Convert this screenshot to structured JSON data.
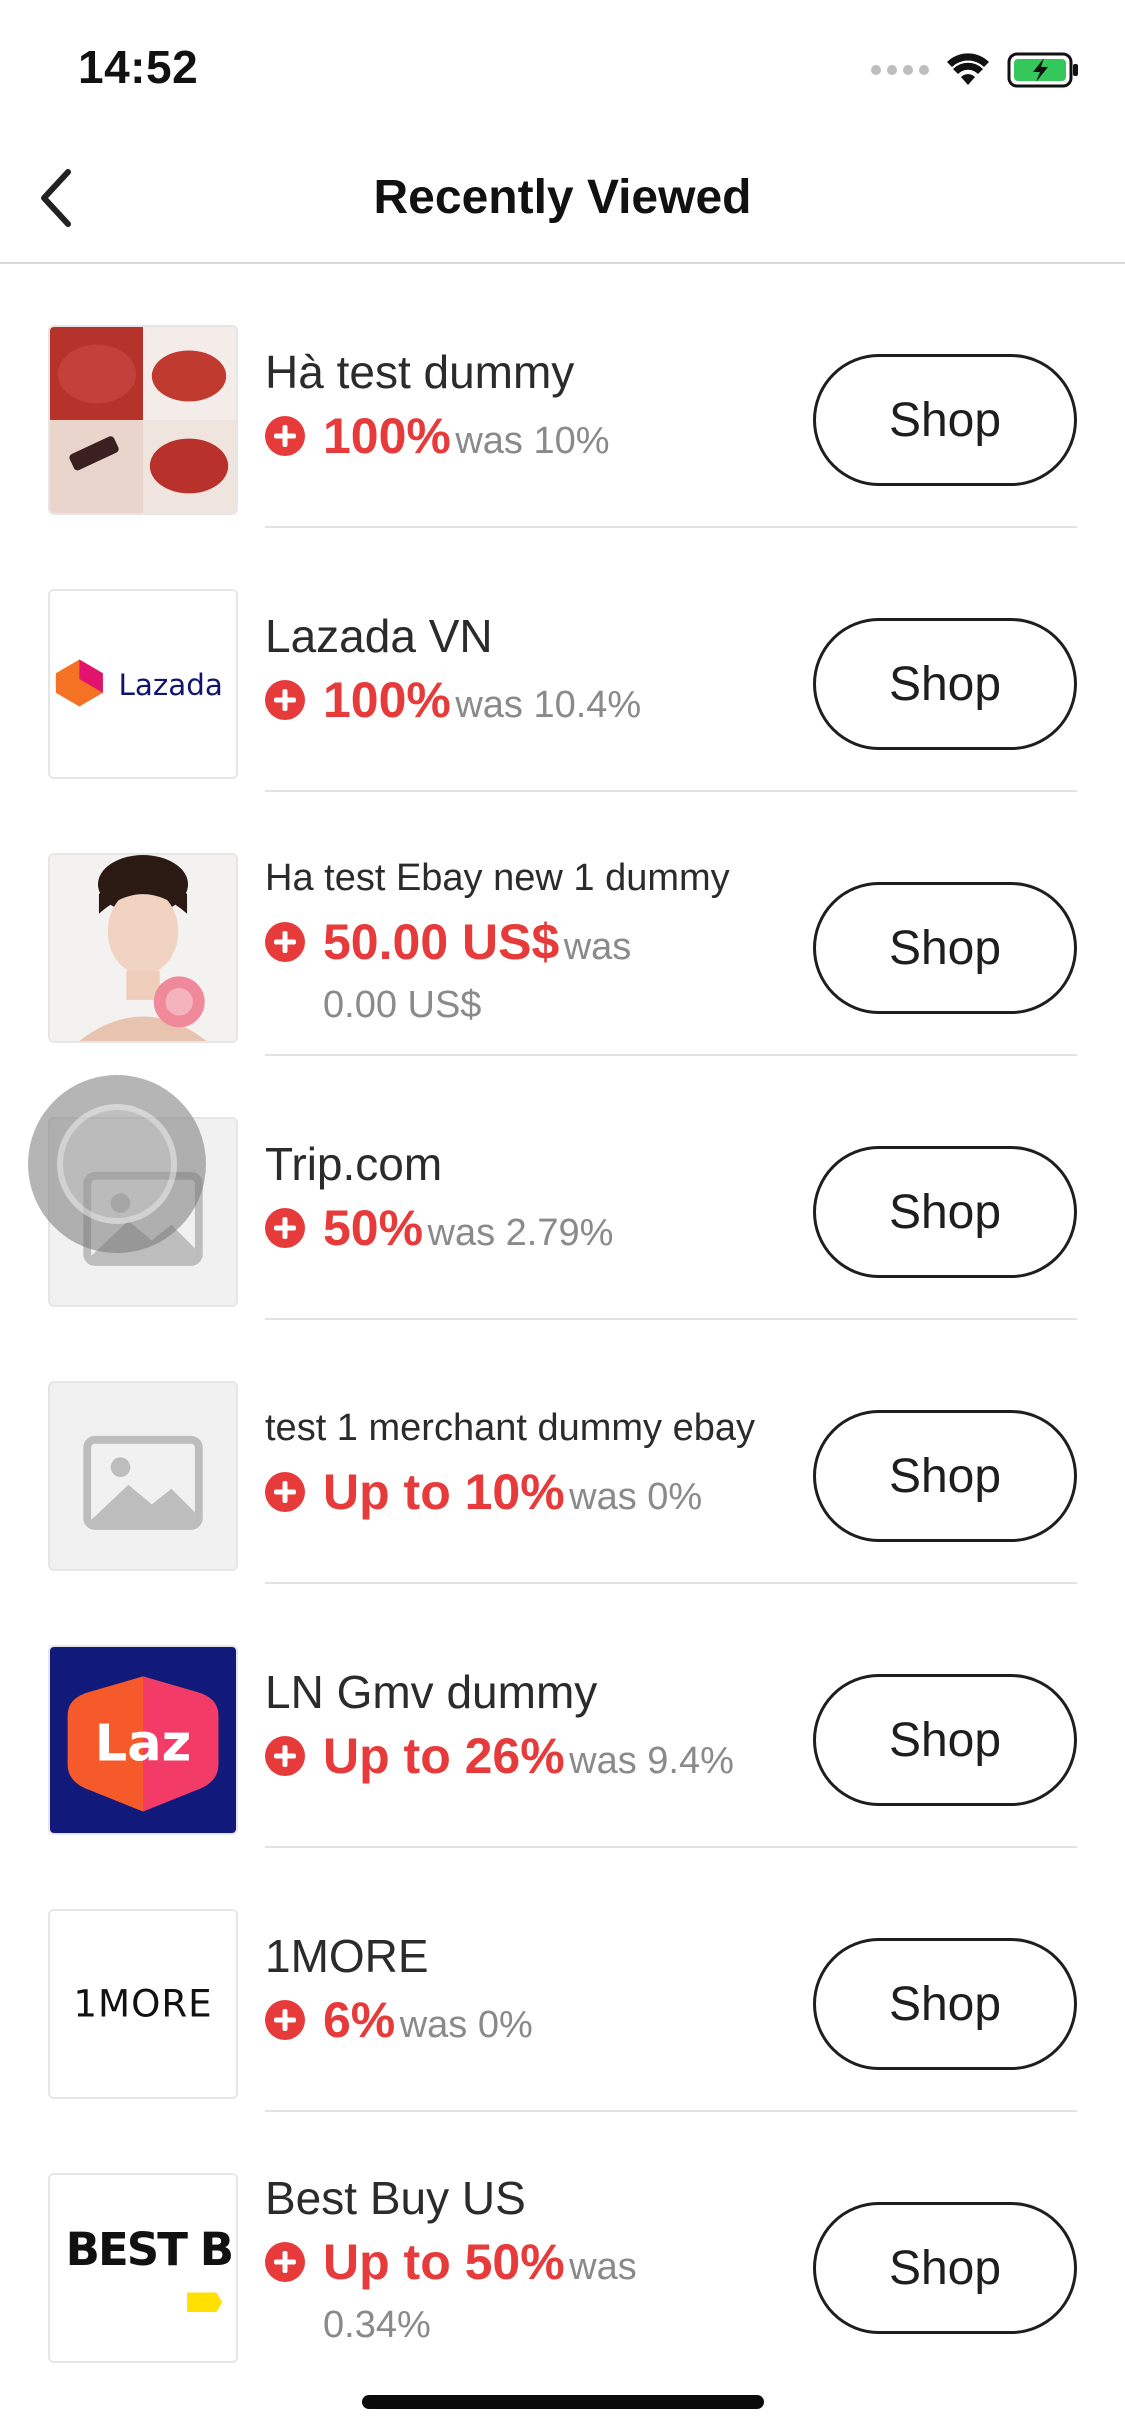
{
  "status_bar": {
    "time": "14:52"
  },
  "header": {
    "title": "Recently Viewed"
  },
  "colors": {
    "accent": "#e73b3b",
    "muted": "#8a8a8a"
  },
  "items": [
    {
      "name": "Hà test dummy",
      "rate": "100%",
      "was": "was 10%",
      "button": "Shop",
      "thumb": "lipstick-photo"
    },
    {
      "name": "Lazada VN",
      "rate": "100%",
      "was": "was 10.4%",
      "button": "Shop",
      "thumb": "lazada-logo",
      "logo_text": "Lazada"
    },
    {
      "name": "Ha test Ebay new 1 dummy",
      "rate": "50.00 US$",
      "was": "was",
      "was2": "0.00 US$",
      "button": "Shop",
      "thumb": "portrait-photo"
    },
    {
      "name": "Trip.com",
      "rate": "50%",
      "was": "was 2.79%",
      "button": "Shop",
      "thumb": "image-placeholder"
    },
    {
      "name": "test 1 merchant dummy ebay",
      "rate": "Up to 10%",
      "was": "was 0%",
      "button": "Shop",
      "thumb": "image-placeholder"
    },
    {
      "name": "LN Gmv dummy",
      "rate": "Up to 26%",
      "was": "was 9.4%",
      "button": "Shop",
      "thumb": "laz-logo",
      "logo_text": "Laz"
    },
    {
      "name": "1MORE",
      "rate": "6%",
      "was": "was 0%",
      "button": "Shop",
      "thumb": "1more-logo",
      "logo_text": "1MORE"
    },
    {
      "name": "Best Buy US",
      "rate": "Up to 50%",
      "was": "was",
      "was2": "0.34%",
      "button": "Shop",
      "thumb": "bestbuy-logo",
      "logo_text": "BEST BUY"
    }
  ]
}
